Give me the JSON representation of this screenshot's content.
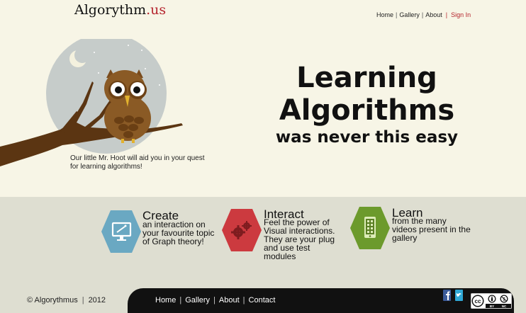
{
  "header": {
    "logo_main": "Algorythm",
    "logo_suffix": ".us",
    "nav": {
      "home": "Home",
      "gallery": "Gallery",
      "about": "About",
      "signin": "Sign In"
    }
  },
  "hero": {
    "line1": "Learning",
    "line2": "Algorithms",
    "line3": "was never this easy",
    "tagline": "Our little Mr. Hoot will aid you in your quest for learning algorithms!"
  },
  "features": [
    {
      "title": "Create",
      "desc": "an interaction on your favourite topic of Graph theory!",
      "icon": "monitor-wand-icon",
      "color": "#6aa8c2"
    },
    {
      "title": "Interact",
      "desc": "Feel the power of Visual interactions. They are your plug and use test modules",
      "icon": "gears-icon",
      "color": "#cc3a3f"
    },
    {
      "title": "Learn",
      "desc": "from the many videos present in the gallery",
      "icon": "mobile-video-icon",
      "color": "#6c9a2c"
    }
  ],
  "footer": {
    "copyright": "© Algorythmus",
    "year": "2012",
    "nav": {
      "home": "Home",
      "gallery": "Gallery",
      "about": "About",
      "contact": "Contact"
    },
    "social": [
      "facebook-icon",
      "twitter-icon"
    ],
    "license": {
      "by": "BY",
      "nc": "NC"
    }
  }
}
